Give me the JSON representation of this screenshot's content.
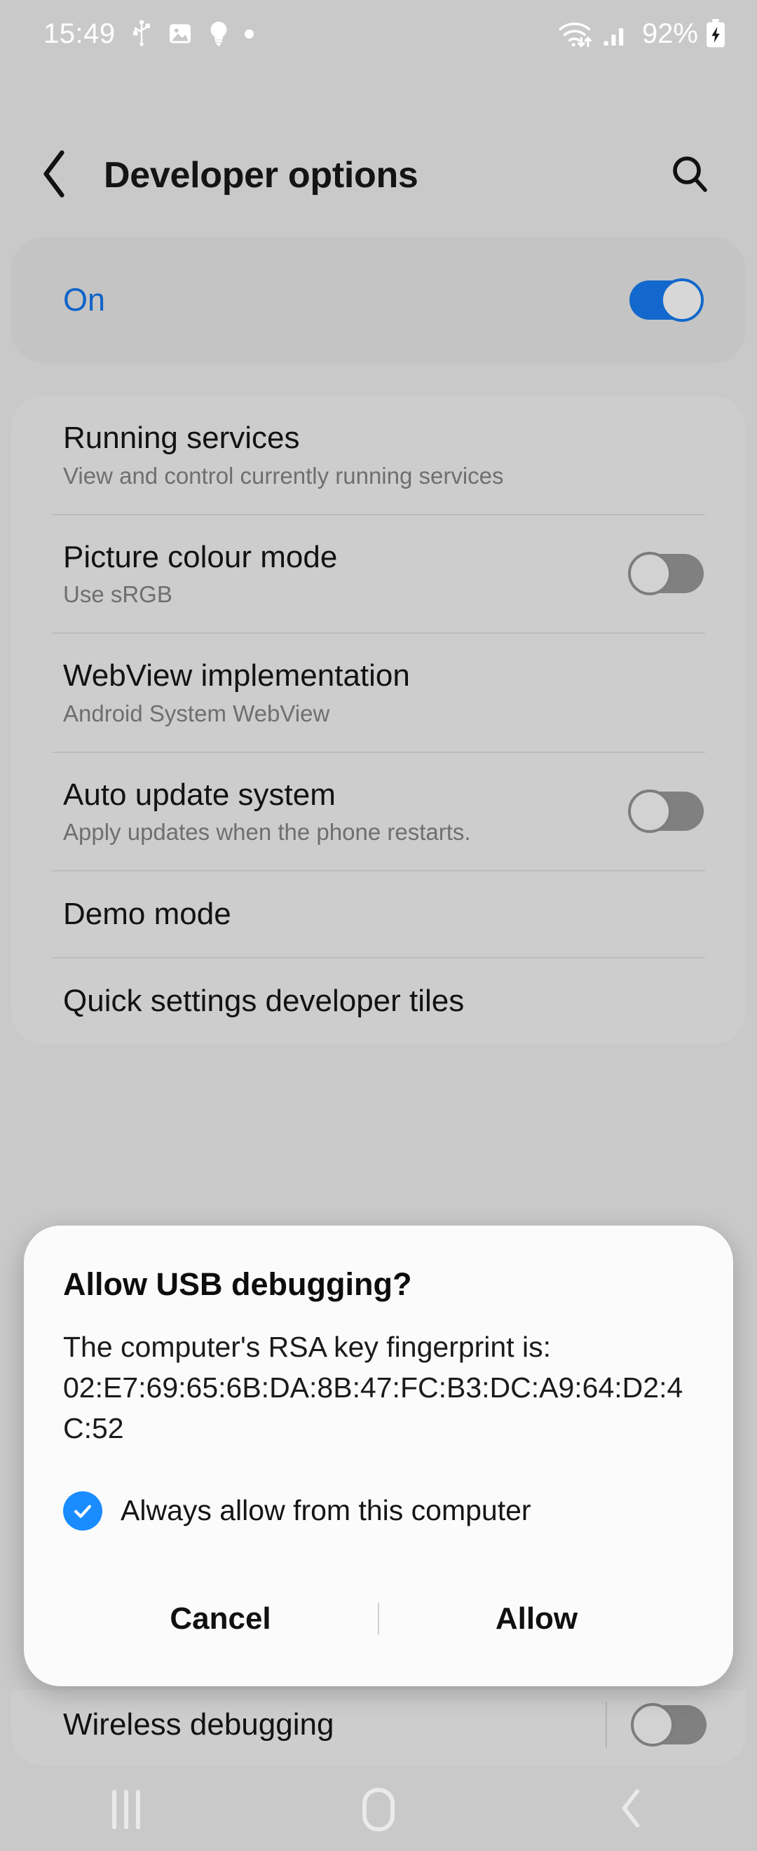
{
  "status_bar": {
    "time": "15:49",
    "left_icons": [
      "usb-icon",
      "image-icon",
      "bulb-icon",
      "dot-icon"
    ],
    "wifi_icon": "wifi-transfer-icon",
    "signal_icon": "signal-bars-icon",
    "battery_percent": "92%",
    "battery_icon": "battery-charging-icon"
  },
  "app_bar": {
    "back_icon": "back-chevron-icon",
    "title": "Developer options",
    "search_icon": "search-icon"
  },
  "master_switch": {
    "label": "On",
    "state": "on"
  },
  "settings": [
    {
      "title": "Running services",
      "subtitle": "View and control currently running services",
      "toggle": null
    },
    {
      "title": "Picture colour mode",
      "subtitle": "Use sRGB",
      "toggle": "off"
    },
    {
      "title": "WebView implementation",
      "subtitle": "Android System WebView",
      "toggle": null
    },
    {
      "title": "Auto update system",
      "subtitle": "Apply updates when the phone restarts.",
      "toggle": "off"
    },
    {
      "title": "Demo mode",
      "subtitle": "",
      "toggle": null
    },
    {
      "title": "Quick settings developer tiles",
      "subtitle": "",
      "toggle": null
    }
  ],
  "background_row": {
    "title": "Wireless debugging",
    "toggle": "off"
  },
  "dialog": {
    "title": "Allow USB debugging?",
    "body_line1": "The computer's RSA key fingerprint is:",
    "fingerprint": "02:E7:69:65:6B:DA:8B:47:FC:B3:DC:A9:64:D2:4C:52",
    "checkbox_label": "Always allow from this computer",
    "checkbox_checked": "checked",
    "cancel_label": "Cancel",
    "allow_label": "Allow"
  },
  "nav_bar": {
    "recents_icon": "recents-icon",
    "home_icon": "home-icon",
    "back_icon": "nav-back-icon"
  },
  "colors": {
    "accent_blue": "#1268cc",
    "checkbox_blue": "#1a8cff",
    "screen_bg": "#c9c9c9",
    "card_bg": "#cdcdcd",
    "dialog_bg": "#fbfbfb"
  }
}
